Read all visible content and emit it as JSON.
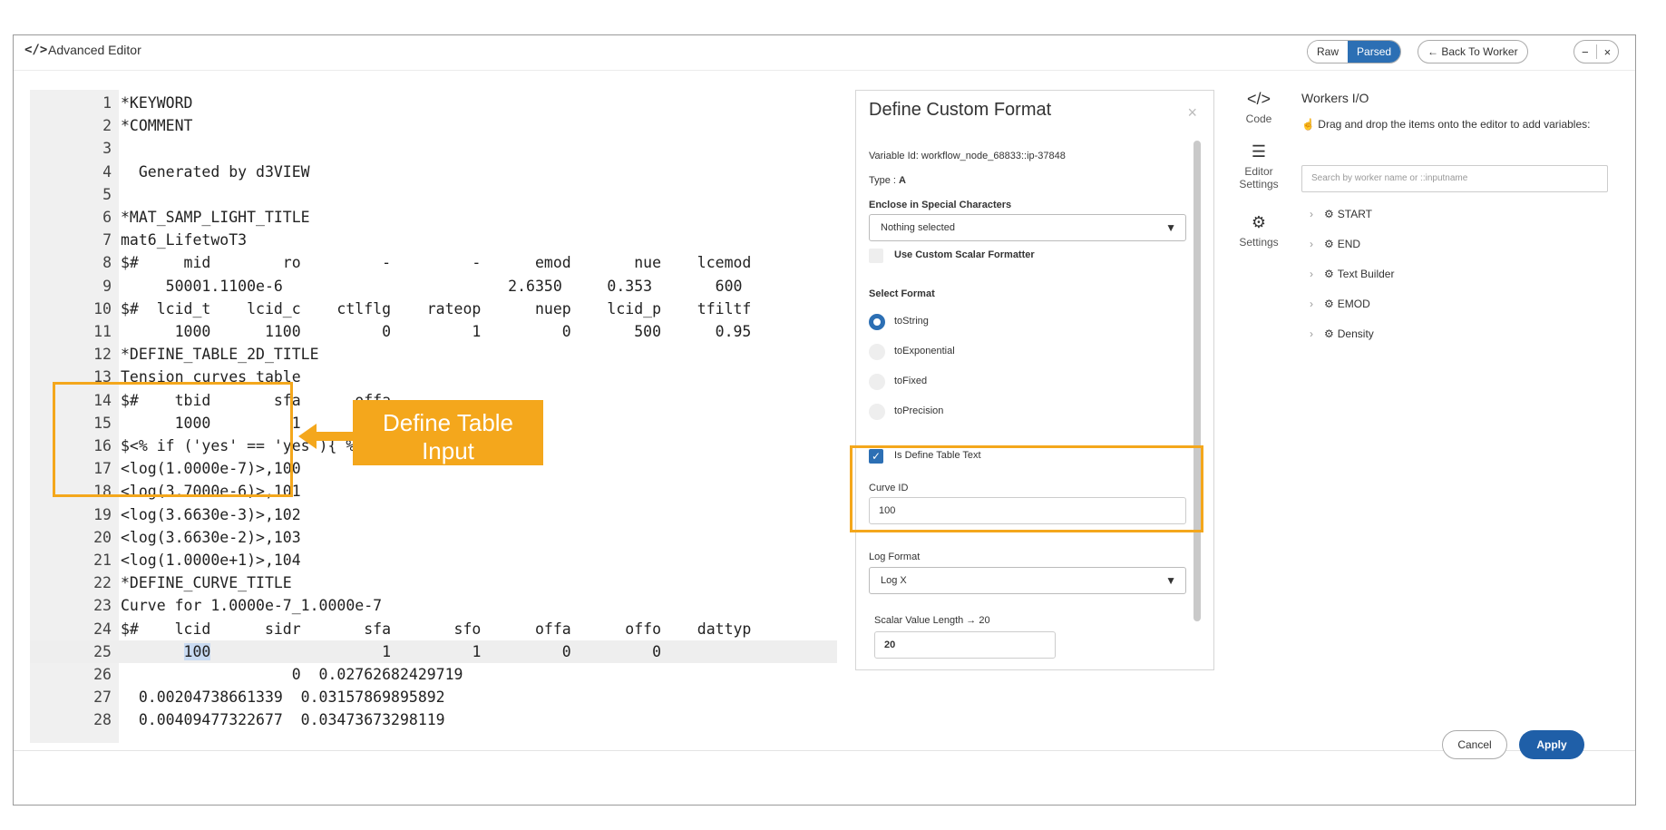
{
  "window": {
    "icon": "code-icon",
    "title": "Advanced Editor",
    "raw_label": "Raw",
    "parsed_label": "Parsed",
    "back_label": "← Back To Worker",
    "minimize_label": "−",
    "close_label": "×"
  },
  "editor": {
    "lines": [
      {
        "n": "1",
        "text": "*KEYWORD"
      },
      {
        "n": "2",
        "text": "*COMMENT"
      },
      {
        "n": "3",
        "text": ""
      },
      {
        "n": "4",
        "text": "  Generated by d3VIEW"
      },
      {
        "n": "5",
        "text": ""
      },
      {
        "n": "6",
        "text": "*MAT_SAMP_LIGHT_TITLE"
      },
      {
        "n": "7",
        "text": "mat6_LifetwoT3"
      },
      {
        "n": "8",
        "text": "$#     mid        ro         -         -      emod       nue    lcemod"
      },
      {
        "n": "9",
        "text": "     50001.1100e-6                         2.6350     0.353       600"
      },
      {
        "n": "10",
        "text": "$#  lcid_t    lcid_c    ctlflg    rateop      nuep    lcid_p    tfiltf"
      },
      {
        "n": "11",
        "text": "      1000      1100         0         1         0       500      0.95"
      },
      {
        "n": "12",
        "text": "*DEFINE_TABLE_2D_TITLE"
      },
      {
        "n": "13",
        "text": "Tension curves table"
      },
      {
        "n": "14",
        "text": "$#    tbid       sfa      offa"
      },
      {
        "n": "15",
        "text": "      1000         1         0"
      },
      {
        "n": "16",
        "text": "$<% if ('yes' == 'yes'){ %>"
      },
      {
        "n": "17",
        "text": "<log(1.0000e-7)>,100"
      },
      {
        "n": "18",
        "text": "<log(3.7000e-6)>,101"
      },
      {
        "n": "19",
        "text": "<log(3.6630e-3)>,102"
      },
      {
        "n": "20",
        "text": "<log(3.6630e-2)>,103"
      },
      {
        "n": "21",
        "text": "<log(1.0000e+1)>,104"
      },
      {
        "n": "22",
        "text": "*DEFINE_CURVE_TITLE"
      },
      {
        "n": "23",
        "text": "Curve for 1.0000e-7_1.0000e-7"
      },
      {
        "n": "24",
        "text": "$#    lcid      sidr       sfa       sfo      offa      offo    dattyp"
      },
      {
        "n": "25",
        "text": "       100                   1         1         0         0"
      },
      {
        "n": "26",
        "text": "                   0  0.02762682429719"
      },
      {
        "n": "27",
        "text": "  0.00204738661339  0.03157869895892"
      },
      {
        "n": "28",
        "text": "  0.00409477322677  0.03473673298119"
      }
    ],
    "selected_text": "100"
  },
  "annotation": {
    "callout_line1": "Define Table",
    "callout_line2": "Input",
    "color": "#f4a71c"
  },
  "custom_format": {
    "title": "Define Custom Format",
    "close_label": "×",
    "variable_id": "Variable Id: workflow_node_68833::ip-37848",
    "type_label": "Type : ",
    "type_value": "A",
    "enclose_label": "Enclose in Special Characters",
    "enclose_value": "Nothing selected",
    "custom_scalar_label": "Use Custom Scalar Formatter",
    "select_format_label": "Select Format",
    "formats": [
      "toString",
      "toExponential",
      "toFixed",
      "toPrecision"
    ],
    "selected_format": "toString",
    "define_table_label": "Is Define Table Text",
    "curve_id_label": "Curve ID",
    "curve_id_value": "100",
    "log_format_label": "Log Format",
    "log_format_value": "Log X",
    "scalar_length_label": "Scalar Value Length  →  20",
    "scalar_length_value": "20"
  },
  "side_tabs": {
    "code": "Code",
    "editor_settings_1": "Editor",
    "editor_settings_2": "Settings",
    "settings": "Settings"
  },
  "workers_io": {
    "title": "Workers I/O",
    "hint": "Drag and drop the items onto the editor to add variables:",
    "search_placeholder": "Search by worker name or ::inputname",
    "items": [
      "START",
      "END",
      "Text Builder",
      "EMOD",
      "Density"
    ]
  },
  "footer": {
    "cancel_label": "Cancel",
    "apply_label": "Apply"
  },
  "colors": {
    "accent_blue": "#1f5fa8",
    "annotation_orange": "#f4a71c"
  }
}
